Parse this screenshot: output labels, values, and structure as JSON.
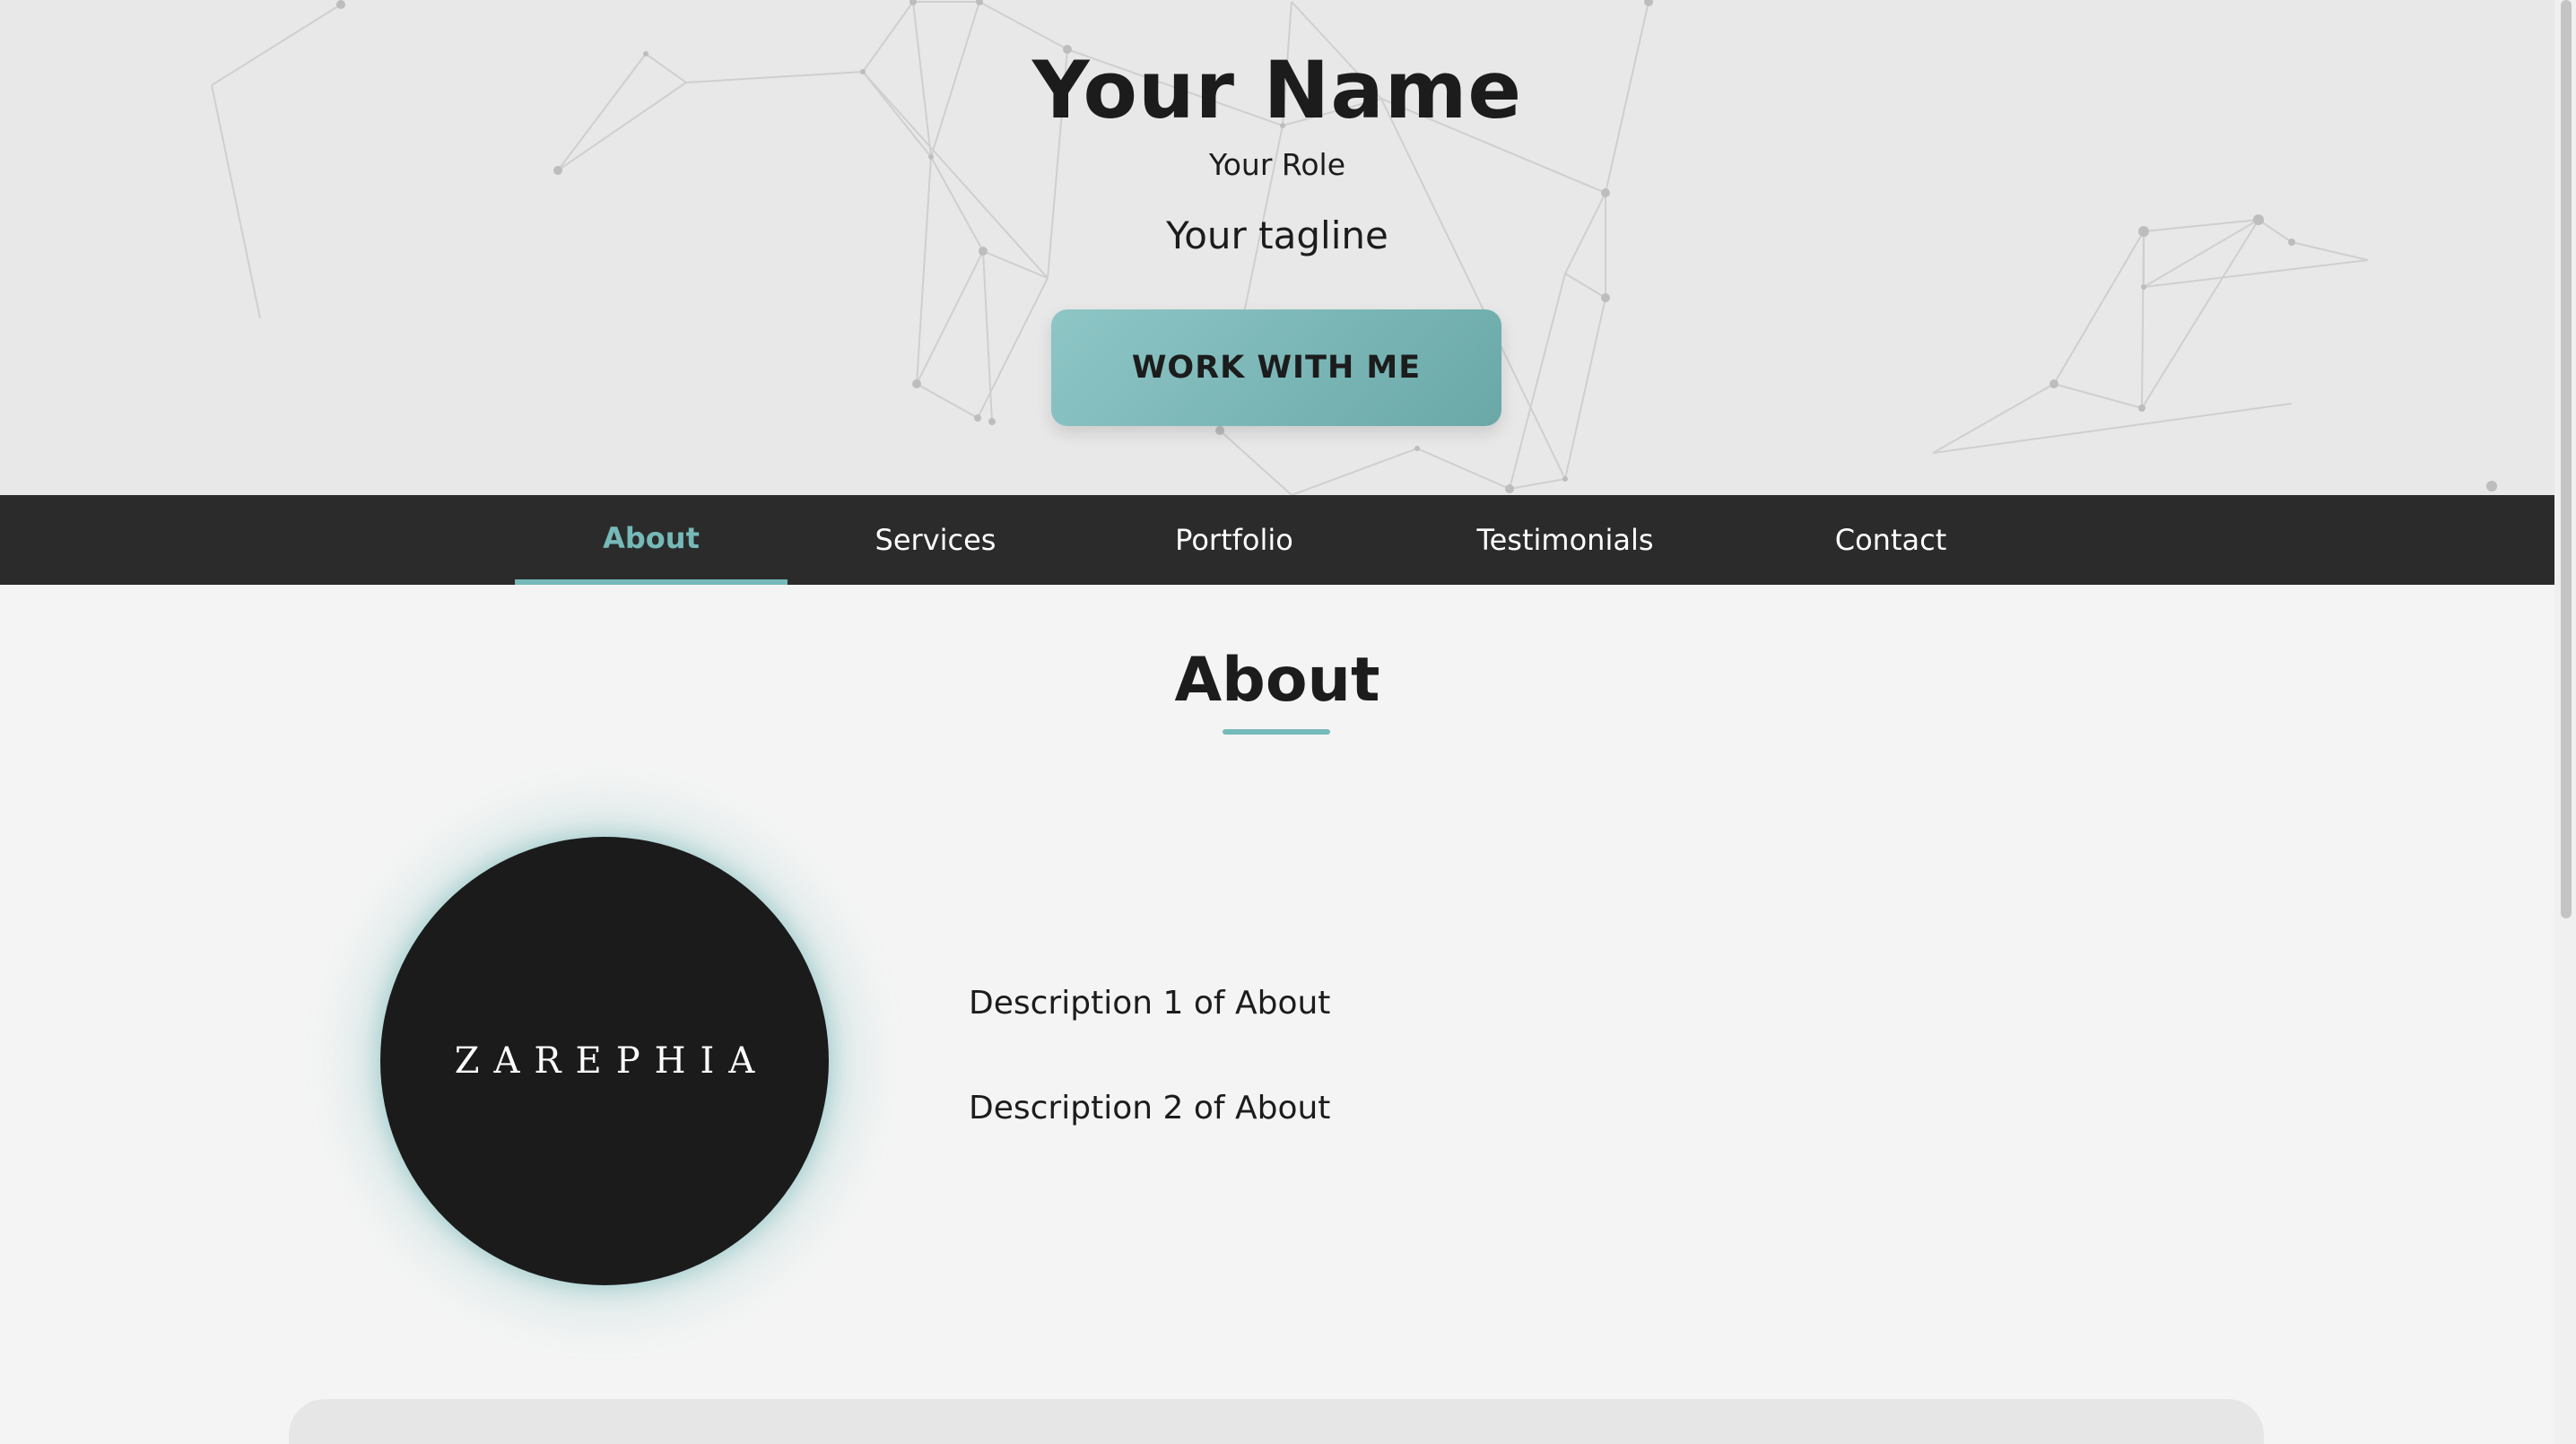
{
  "hero": {
    "name": "Your Name",
    "role": "Your Role",
    "tagline": "Your tagline",
    "cta_label": "WORK WITH ME"
  },
  "nav": {
    "items": [
      {
        "label": "About",
        "active": true
      },
      {
        "label": "Services",
        "active": false
      },
      {
        "label": "Portfolio",
        "active": false
      },
      {
        "label": "Testimonials",
        "active": false
      },
      {
        "label": "Contact",
        "active": false
      }
    ]
  },
  "about": {
    "title": "About",
    "avatar_text": "ZAREPHIA",
    "descriptions": [
      "Description 1 of About",
      "Description 2 of About"
    ]
  },
  "colors": {
    "accent": "#76b9b9",
    "nav_background": "#2b2b2b",
    "hero_background": "#e8e8e8",
    "page_background": "#f4f4f4",
    "text": "#1c1c1c"
  }
}
